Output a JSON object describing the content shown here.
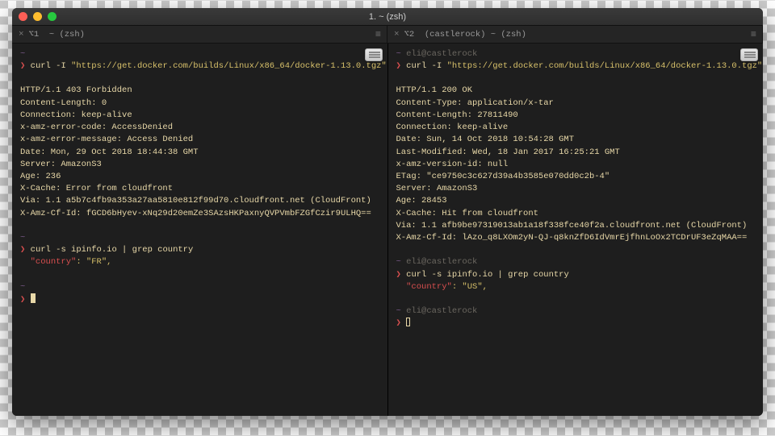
{
  "window": {
    "title": "1. ~ (zsh)"
  },
  "tabs": [
    {
      "icon": "⌥1",
      "label": "~ (zsh)"
    },
    {
      "icon": "⌥2",
      "label": "(castlerock) ~ (zsh)"
    }
  ],
  "left": {
    "cmd1": "curl -I \"https://get.docker.com/builds/Linux/x86_64/docker-1.13.0.tgz\"",
    "response": [
      "HTTP/1.1 403 Forbidden",
      "Content-Length: 0",
      "Connection: keep-alive",
      "x-amz-error-code: AccessDenied",
      "x-amz-error-message: Access Denied",
      "Date: Mon, 29 Oct 2018 18:44:38 GMT",
      "Server: AmazonS3",
      "Age: 236",
      "X-Cache: Error from cloudfront",
      "Via: 1.1 a5b7c4fb9a353a27aa5810e812f99d70.cloudfront.net (CloudFront)",
      "X-Amz-Cf-Id: fGCD6bHyev-xNq29d20emZe3SAzsHKPaxnyQVPVmbFZGfCzir9ULHQ=="
    ],
    "cmd2": "curl -s ipinfo.io | grep country",
    "country_key": "\"country\"",
    "country_val": ": \"FR\","
  },
  "right": {
    "context": "eli@castlerock",
    "cmd1": "curl -I \"https://get.docker.com/builds/Linux/x86_64/docker-1.13.0.tgz\"",
    "response": [
      "HTTP/1.1 200 OK",
      "Content-Type: application/x-tar",
      "Content-Length: 27811490",
      "Connection: keep-alive",
      "Date: Sun, 14 Oct 2018 10:54:28 GMT",
      "Last-Modified: Wed, 18 Jan 2017 16:25:21 GMT",
      "x-amz-version-id: null",
      "ETag: \"ce9750c3c627d39a4b3585e070dd0c2b-4\"",
      "Server: AmazonS3",
      "Age: 28453",
      "X-Cache: Hit from cloudfront",
      "Via: 1.1 afb9be97319013ab1a18f338fce40f2a.cloudfront.net (CloudFront)",
      "X-Amz-Cf-Id: lAzo_q8LXOm2yN-QJ-q8knZfD6IdVmrEjfhnLoOx2TCDrUF3eZqMAA=="
    ],
    "cmd2": "curl -s ipinfo.io | grep country",
    "country_key": "\"country\"",
    "country_val": ": \"US\","
  }
}
